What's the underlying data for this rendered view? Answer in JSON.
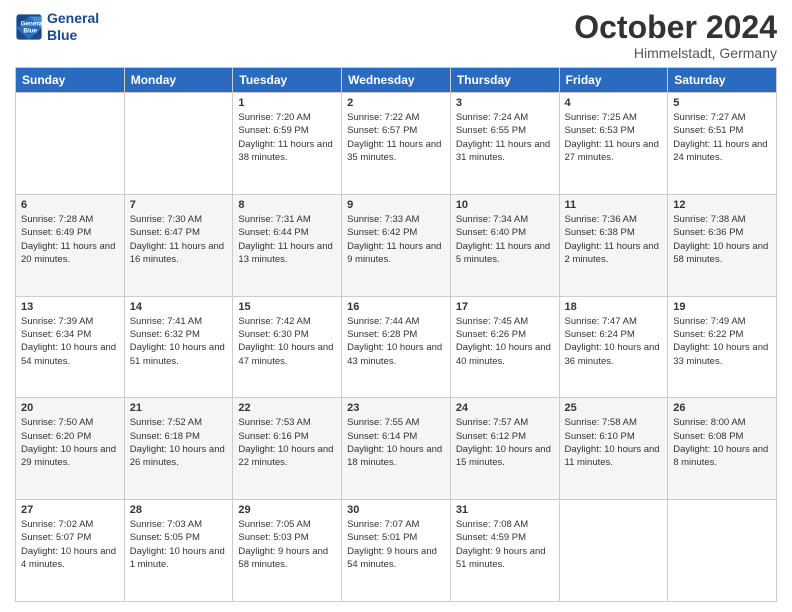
{
  "logo": {
    "line1": "General",
    "line2": "Blue"
  },
  "title": "October 2024",
  "location": "Himmelstadt, Germany",
  "headers": [
    "Sunday",
    "Monday",
    "Tuesday",
    "Wednesday",
    "Thursday",
    "Friday",
    "Saturday"
  ],
  "weeks": [
    [
      {
        "day": "",
        "sunrise": "",
        "sunset": "",
        "daylight": ""
      },
      {
        "day": "",
        "sunrise": "",
        "sunset": "",
        "daylight": ""
      },
      {
        "day": "1",
        "sunrise": "Sunrise: 7:20 AM",
        "sunset": "Sunset: 6:59 PM",
        "daylight": "Daylight: 11 hours and 38 minutes."
      },
      {
        "day": "2",
        "sunrise": "Sunrise: 7:22 AM",
        "sunset": "Sunset: 6:57 PM",
        "daylight": "Daylight: 11 hours and 35 minutes."
      },
      {
        "day": "3",
        "sunrise": "Sunrise: 7:24 AM",
        "sunset": "Sunset: 6:55 PM",
        "daylight": "Daylight: 11 hours and 31 minutes."
      },
      {
        "day": "4",
        "sunrise": "Sunrise: 7:25 AM",
        "sunset": "Sunset: 6:53 PM",
        "daylight": "Daylight: 11 hours and 27 minutes."
      },
      {
        "day": "5",
        "sunrise": "Sunrise: 7:27 AM",
        "sunset": "Sunset: 6:51 PM",
        "daylight": "Daylight: 11 hours and 24 minutes."
      }
    ],
    [
      {
        "day": "6",
        "sunrise": "Sunrise: 7:28 AM",
        "sunset": "Sunset: 6:49 PM",
        "daylight": "Daylight: 11 hours and 20 minutes."
      },
      {
        "day": "7",
        "sunrise": "Sunrise: 7:30 AM",
        "sunset": "Sunset: 6:47 PM",
        "daylight": "Daylight: 11 hours and 16 minutes."
      },
      {
        "day": "8",
        "sunrise": "Sunrise: 7:31 AM",
        "sunset": "Sunset: 6:44 PM",
        "daylight": "Daylight: 11 hours and 13 minutes."
      },
      {
        "day": "9",
        "sunrise": "Sunrise: 7:33 AM",
        "sunset": "Sunset: 6:42 PM",
        "daylight": "Daylight: 11 hours and 9 minutes."
      },
      {
        "day": "10",
        "sunrise": "Sunrise: 7:34 AM",
        "sunset": "Sunset: 6:40 PM",
        "daylight": "Daylight: 11 hours and 5 minutes."
      },
      {
        "day": "11",
        "sunrise": "Sunrise: 7:36 AM",
        "sunset": "Sunset: 6:38 PM",
        "daylight": "Daylight: 11 hours and 2 minutes."
      },
      {
        "day": "12",
        "sunrise": "Sunrise: 7:38 AM",
        "sunset": "Sunset: 6:36 PM",
        "daylight": "Daylight: 10 hours and 58 minutes."
      }
    ],
    [
      {
        "day": "13",
        "sunrise": "Sunrise: 7:39 AM",
        "sunset": "Sunset: 6:34 PM",
        "daylight": "Daylight: 10 hours and 54 minutes."
      },
      {
        "day": "14",
        "sunrise": "Sunrise: 7:41 AM",
        "sunset": "Sunset: 6:32 PM",
        "daylight": "Daylight: 10 hours and 51 minutes."
      },
      {
        "day": "15",
        "sunrise": "Sunrise: 7:42 AM",
        "sunset": "Sunset: 6:30 PM",
        "daylight": "Daylight: 10 hours and 47 minutes."
      },
      {
        "day": "16",
        "sunrise": "Sunrise: 7:44 AM",
        "sunset": "Sunset: 6:28 PM",
        "daylight": "Daylight: 10 hours and 43 minutes."
      },
      {
        "day": "17",
        "sunrise": "Sunrise: 7:45 AM",
        "sunset": "Sunset: 6:26 PM",
        "daylight": "Daylight: 10 hours and 40 minutes."
      },
      {
        "day": "18",
        "sunrise": "Sunrise: 7:47 AM",
        "sunset": "Sunset: 6:24 PM",
        "daylight": "Daylight: 10 hours and 36 minutes."
      },
      {
        "day": "19",
        "sunrise": "Sunrise: 7:49 AM",
        "sunset": "Sunset: 6:22 PM",
        "daylight": "Daylight: 10 hours and 33 minutes."
      }
    ],
    [
      {
        "day": "20",
        "sunrise": "Sunrise: 7:50 AM",
        "sunset": "Sunset: 6:20 PM",
        "daylight": "Daylight: 10 hours and 29 minutes."
      },
      {
        "day": "21",
        "sunrise": "Sunrise: 7:52 AM",
        "sunset": "Sunset: 6:18 PM",
        "daylight": "Daylight: 10 hours and 26 minutes."
      },
      {
        "day": "22",
        "sunrise": "Sunrise: 7:53 AM",
        "sunset": "Sunset: 6:16 PM",
        "daylight": "Daylight: 10 hours and 22 minutes."
      },
      {
        "day": "23",
        "sunrise": "Sunrise: 7:55 AM",
        "sunset": "Sunset: 6:14 PM",
        "daylight": "Daylight: 10 hours and 18 minutes."
      },
      {
        "day": "24",
        "sunrise": "Sunrise: 7:57 AM",
        "sunset": "Sunset: 6:12 PM",
        "daylight": "Daylight: 10 hours and 15 minutes."
      },
      {
        "day": "25",
        "sunrise": "Sunrise: 7:58 AM",
        "sunset": "Sunset: 6:10 PM",
        "daylight": "Daylight: 10 hours and 11 minutes."
      },
      {
        "day": "26",
        "sunrise": "Sunrise: 8:00 AM",
        "sunset": "Sunset: 6:08 PM",
        "daylight": "Daylight: 10 hours and 8 minutes."
      }
    ],
    [
      {
        "day": "27",
        "sunrise": "Sunrise: 7:02 AM",
        "sunset": "Sunset: 5:07 PM",
        "daylight": "Daylight: 10 hours and 4 minutes."
      },
      {
        "day": "28",
        "sunrise": "Sunrise: 7:03 AM",
        "sunset": "Sunset: 5:05 PM",
        "daylight": "Daylight: 10 hours and 1 minute."
      },
      {
        "day": "29",
        "sunrise": "Sunrise: 7:05 AM",
        "sunset": "Sunset: 5:03 PM",
        "daylight": "Daylight: 9 hours and 58 minutes."
      },
      {
        "day": "30",
        "sunrise": "Sunrise: 7:07 AM",
        "sunset": "Sunset: 5:01 PM",
        "daylight": "Daylight: 9 hours and 54 minutes."
      },
      {
        "day": "31",
        "sunrise": "Sunrise: 7:08 AM",
        "sunset": "Sunset: 4:59 PM",
        "daylight": "Daylight: 9 hours and 51 minutes."
      },
      {
        "day": "",
        "sunrise": "",
        "sunset": "",
        "daylight": ""
      },
      {
        "day": "",
        "sunrise": "",
        "sunset": "",
        "daylight": ""
      }
    ]
  ]
}
